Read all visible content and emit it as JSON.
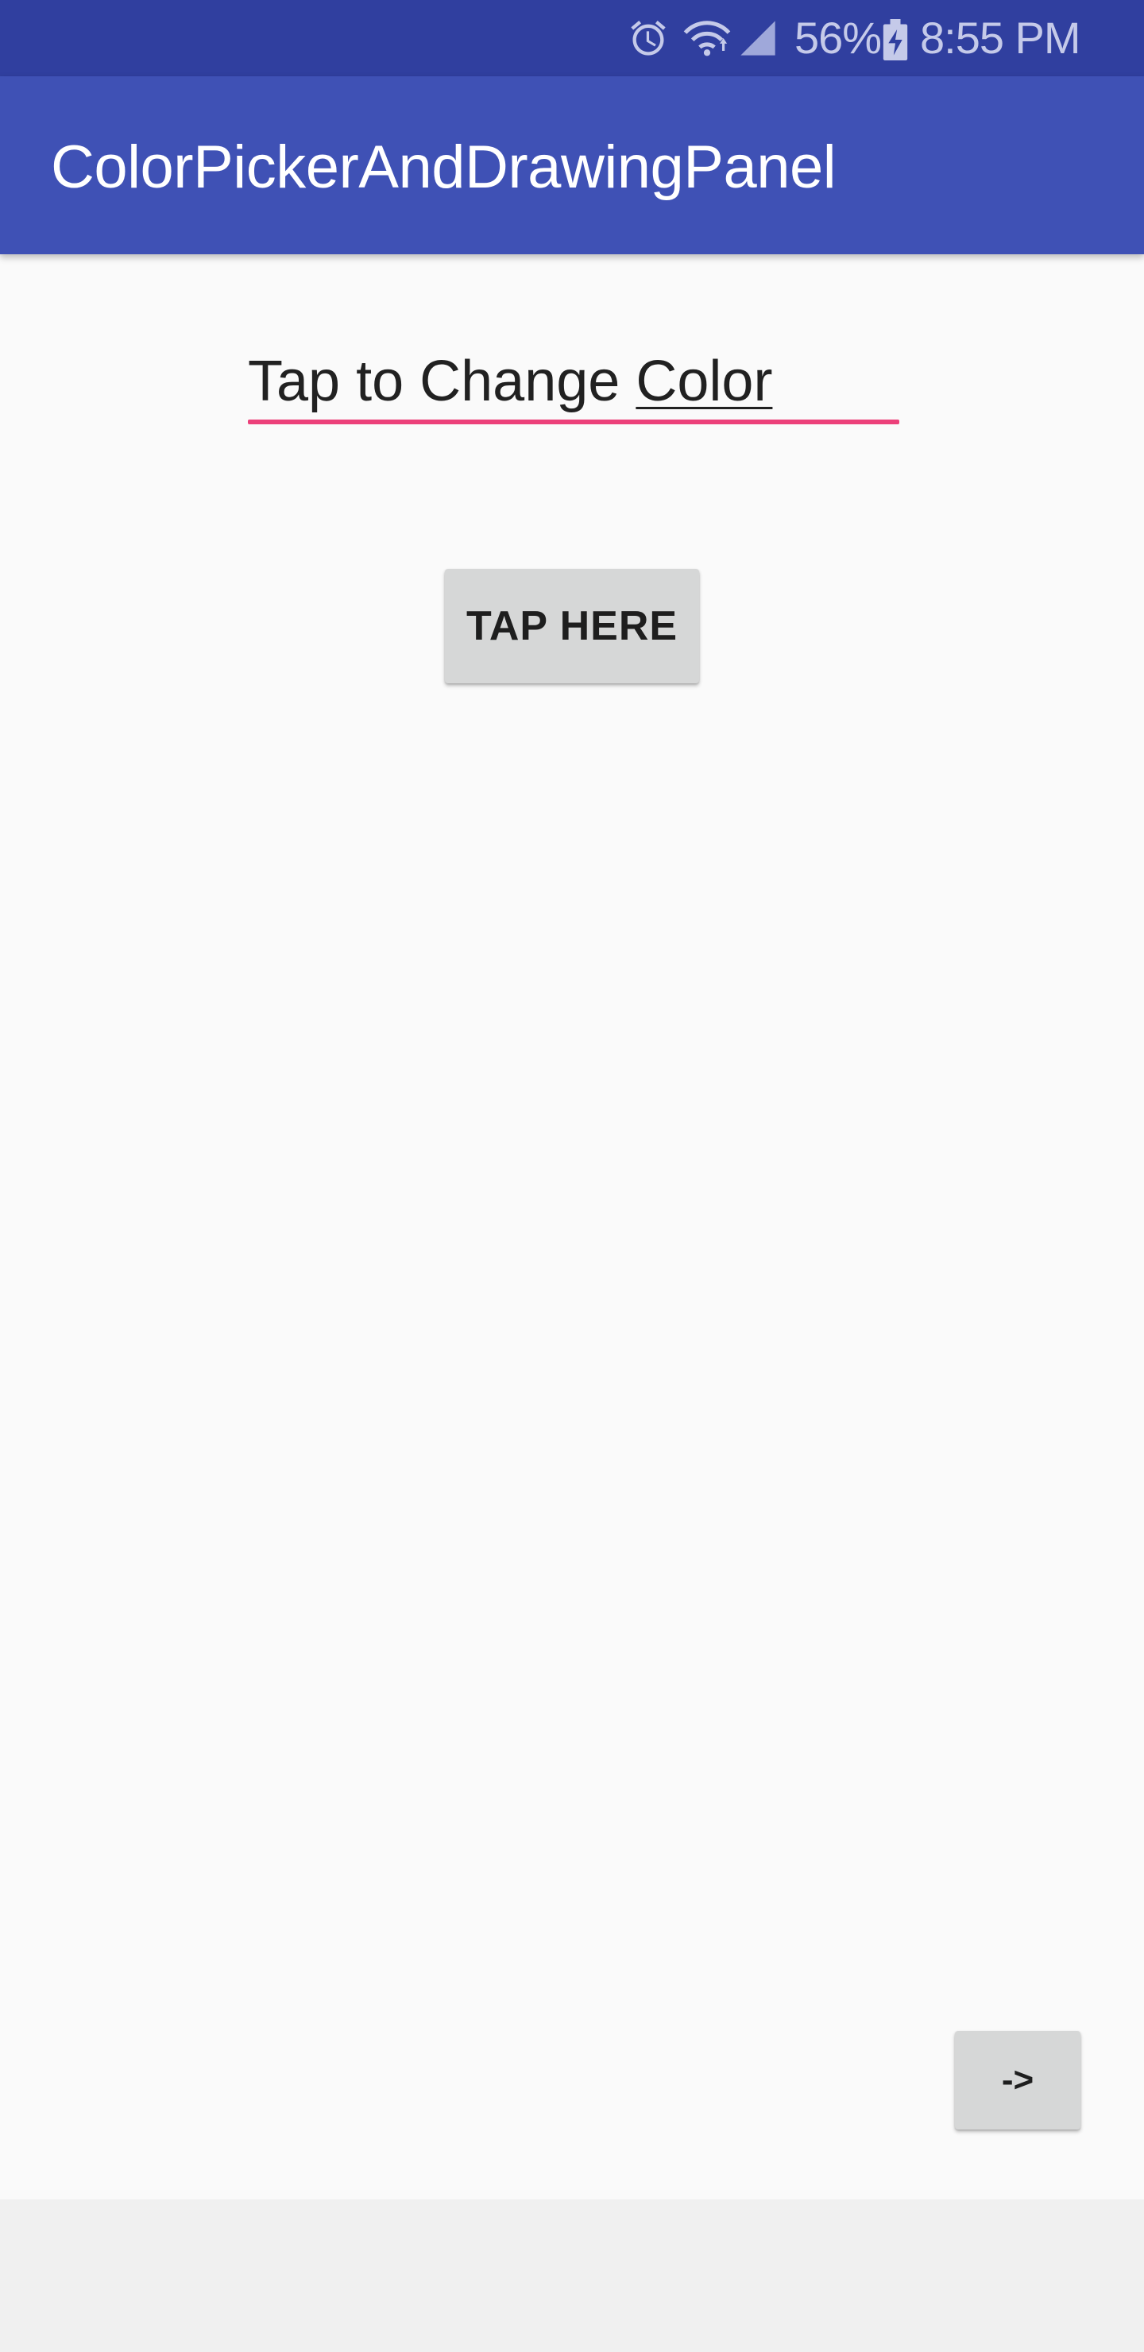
{
  "status_bar": {
    "battery_percent": "56%",
    "time": "8:55 PM",
    "icons": [
      "alarm-icon",
      "wifi-icon",
      "signal-icon",
      "battery-charging-icon"
    ],
    "color": "#303f9f"
  },
  "app_bar": {
    "title": "ColorPickerAndDrawingPanel",
    "color": "#3f51b5"
  },
  "edit_text": {
    "value_plain": "Tap to Change ",
    "value_underlined": "Color",
    "accent_color": "#ec407a"
  },
  "tap_button": {
    "label": "TAP HERE"
  },
  "next_button": {
    "label": "->"
  }
}
